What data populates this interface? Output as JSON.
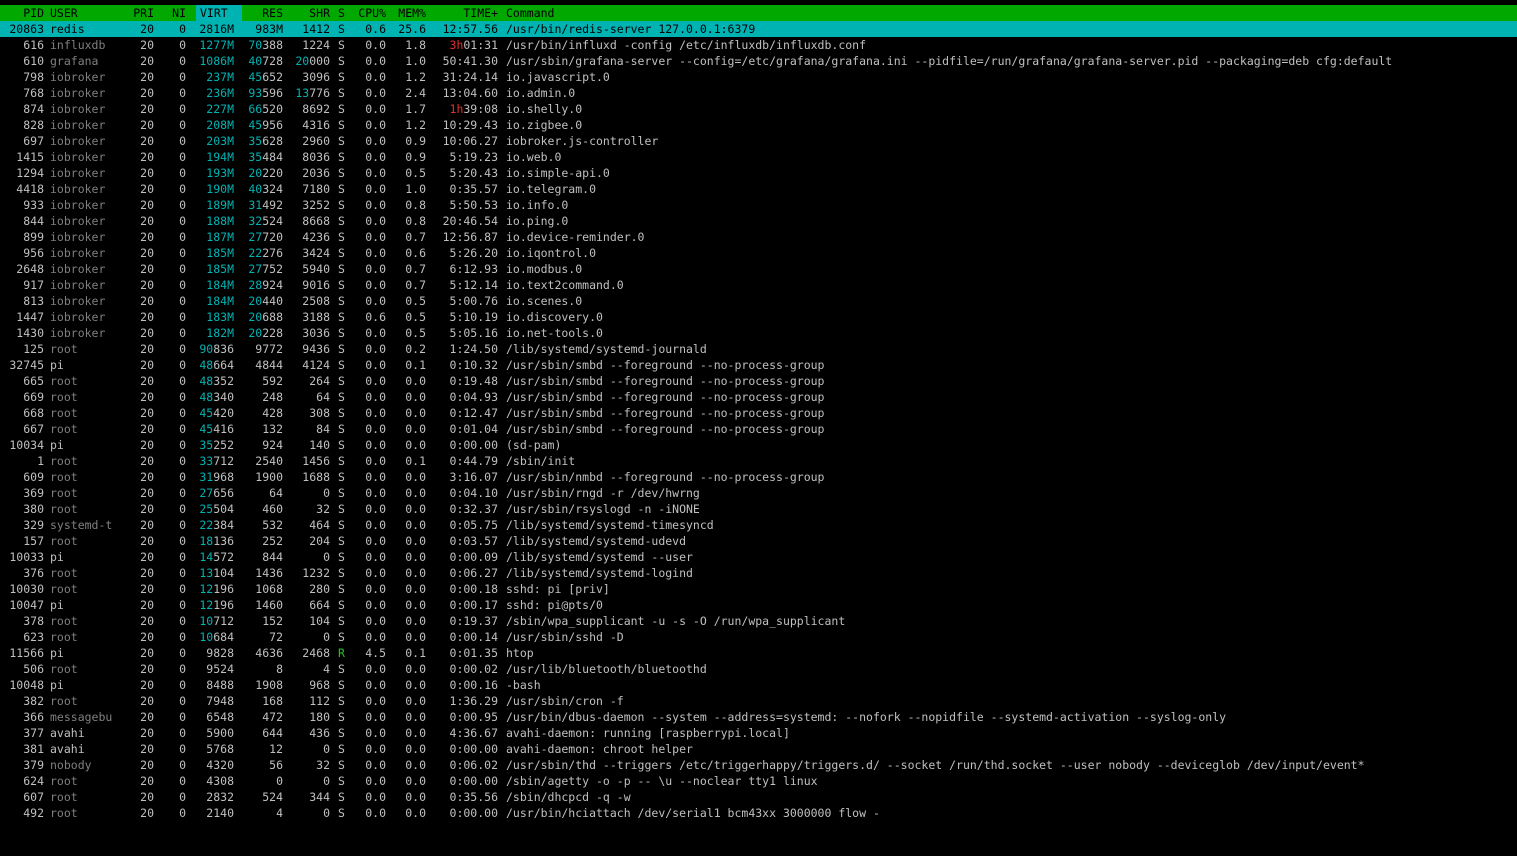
{
  "header": {
    "pid": "PID",
    "user": "USER",
    "pri": "PRI",
    "ni": "NI",
    "virt": "VIRT",
    "res": "RES",
    "shr": "SHR",
    "s": "S",
    "cpu": "CPU%",
    "mem": "MEM%",
    "time": "TIME+",
    "command": "Command"
  },
  "colors": {
    "header_bg": "#00a800",
    "selection_bg": "#00b3b3",
    "virt_cyan": "#00b3b3",
    "time_hours_red": "#e03030",
    "running_green": "#22c322",
    "background": "#000000"
  },
  "processes": [
    {
      "pid": "20863",
      "user": "redis",
      "pri": "20",
      "ni": "0",
      "virt": "2816M",
      "res": "983M",
      "shr": "1412",
      "s": "S",
      "cpu": "0.6",
      "mem": "25.6",
      "time_h": "",
      "time": "12:57.56",
      "command": "/usr/bin/redis-server 127.0.0.1:6379"
    },
    {
      "pid": "616",
      "user": "influxdb",
      "pri": "20",
      "ni": "0",
      "virt": "1277M",
      "res": "70388",
      "shr": "1224",
      "s": "S",
      "cpu": "0.0",
      "mem": "1.8",
      "time_h": "3h",
      "time": "01:31",
      "command": "/usr/bin/influxd -config /etc/influxdb/influxdb.conf"
    },
    {
      "pid": "610",
      "user": "grafana",
      "pri": "20",
      "ni": "0",
      "virt": "1086M",
      "res": "40728",
      "shr": "20000",
      "s": "S",
      "cpu": "0.0",
      "mem": "1.0",
      "time_h": "",
      "time": "50:41.30",
      "command": "/usr/sbin/grafana-server --config=/etc/grafana/grafana.ini --pidfile=/run/grafana/grafana-server.pid --packaging=deb cfg:default"
    },
    {
      "pid": "798",
      "user": "iobroker",
      "pri": "20",
      "ni": "0",
      "virt": "237M",
      "res": "45652",
      "shr": "3096",
      "s": "S",
      "cpu": "0.0",
      "mem": "1.2",
      "time_h": "",
      "time": "31:24.14",
      "command": "io.javascript.0"
    },
    {
      "pid": "768",
      "user": "iobroker",
      "pri": "20",
      "ni": "0",
      "virt": "236M",
      "res": "93596",
      "shr": "13776",
      "s": "S",
      "cpu": "0.0",
      "mem": "2.4",
      "time_h": "",
      "time": "13:04.60",
      "command": "io.admin.0"
    },
    {
      "pid": "874",
      "user": "iobroker",
      "pri": "20",
      "ni": "0",
      "virt": "227M",
      "res": "66520",
      "shr": "8692",
      "s": "S",
      "cpu": "0.0",
      "mem": "1.7",
      "time_h": "1h",
      "time": "39:08",
      "command": "io.shelly.0"
    },
    {
      "pid": "828",
      "user": "iobroker",
      "pri": "20",
      "ni": "0",
      "virt": "208M",
      "res": "45956",
      "shr": "4316",
      "s": "S",
      "cpu": "0.0",
      "mem": "1.2",
      "time_h": "",
      "time": "10:29.43",
      "command": "io.zigbee.0"
    },
    {
      "pid": "697",
      "user": "iobroker",
      "pri": "20",
      "ni": "0",
      "virt": "203M",
      "res": "35628",
      "shr": "2960",
      "s": "S",
      "cpu": "0.0",
      "mem": "0.9",
      "time_h": "",
      "time": "10:06.27",
      "command": "iobroker.js-controller"
    },
    {
      "pid": "1415",
      "user": "iobroker",
      "pri": "20",
      "ni": "0",
      "virt": "194M",
      "res": "35484",
      "shr": "8036",
      "s": "S",
      "cpu": "0.0",
      "mem": "0.9",
      "time_h": "",
      "time": "5:19.23",
      "command": "io.web.0"
    },
    {
      "pid": "1294",
      "user": "iobroker",
      "pri": "20",
      "ni": "0",
      "virt": "193M",
      "res": "20220",
      "shr": "2036",
      "s": "S",
      "cpu": "0.0",
      "mem": "0.5",
      "time_h": "",
      "time": "5:20.43",
      "command": "io.simple-api.0"
    },
    {
      "pid": "4418",
      "user": "iobroker",
      "pri": "20",
      "ni": "0",
      "virt": "190M",
      "res": "40324",
      "shr": "7180",
      "s": "S",
      "cpu": "0.0",
      "mem": "1.0",
      "time_h": "",
      "time": "0:35.57",
      "command": "io.telegram.0"
    },
    {
      "pid": "933",
      "user": "iobroker",
      "pri": "20",
      "ni": "0",
      "virt": "189M",
      "res": "31492",
      "shr": "3252",
      "s": "S",
      "cpu": "0.0",
      "mem": "0.8",
      "time_h": "",
      "time": "5:50.53",
      "command": "io.info.0"
    },
    {
      "pid": "844",
      "user": "iobroker",
      "pri": "20",
      "ni": "0",
      "virt": "188M",
      "res": "32524",
      "shr": "8668",
      "s": "S",
      "cpu": "0.0",
      "mem": "0.8",
      "time_h": "",
      "time": "20:46.54",
      "command": "io.ping.0"
    },
    {
      "pid": "899",
      "user": "iobroker",
      "pri": "20",
      "ni": "0",
      "virt": "187M",
      "res": "27720",
      "shr": "4236",
      "s": "S",
      "cpu": "0.0",
      "mem": "0.7",
      "time_h": "",
      "time": "12:56.87",
      "command": "io.device-reminder.0"
    },
    {
      "pid": "956",
      "user": "iobroker",
      "pri": "20",
      "ni": "0",
      "virt": "185M",
      "res": "22276",
      "shr": "3424",
      "s": "S",
      "cpu": "0.0",
      "mem": "0.6",
      "time_h": "",
      "time": "5:26.20",
      "command": "io.iqontrol.0"
    },
    {
      "pid": "2648",
      "user": "iobroker",
      "pri": "20",
      "ni": "0",
      "virt": "185M",
      "res": "27752",
      "shr": "5940",
      "s": "S",
      "cpu": "0.0",
      "mem": "0.7",
      "time_h": "",
      "time": "6:12.93",
      "command": "io.modbus.0"
    },
    {
      "pid": "917",
      "user": "iobroker",
      "pri": "20",
      "ni": "0",
      "virt": "184M",
      "res": "28924",
      "shr": "9016",
      "s": "S",
      "cpu": "0.0",
      "mem": "0.7",
      "time_h": "",
      "time": "5:12.14",
      "command": "io.text2command.0"
    },
    {
      "pid": "813",
      "user": "iobroker",
      "pri": "20",
      "ni": "0",
      "virt": "184M",
      "res": "20440",
      "shr": "2508",
      "s": "S",
      "cpu": "0.0",
      "mem": "0.5",
      "time_h": "",
      "time": "5:00.76",
      "command": "io.scenes.0"
    },
    {
      "pid": "1447",
      "user": "iobroker",
      "pri": "20",
      "ni": "0",
      "virt": "183M",
      "res": "20688",
      "shr": "3188",
      "s": "S",
      "cpu": "0.6",
      "mem": "0.5",
      "time_h": "",
      "time": "5:10.19",
      "command": "io.discovery.0"
    },
    {
      "pid": "1430",
      "user": "iobroker",
      "pri": "20",
      "ni": "0",
      "virt": "182M",
      "res": "20228",
      "shr": "3036",
      "s": "S",
      "cpu": "0.0",
      "mem": "0.5",
      "time_h": "",
      "time": "5:05.16",
      "command": "io.net-tools.0"
    },
    {
      "pid": "125",
      "user": "root",
      "pri": "20",
      "ni": "0",
      "virt": "90836",
      "res": "9772",
      "shr": "9436",
      "s": "S",
      "cpu": "0.0",
      "mem": "0.2",
      "time_h": "",
      "time": "1:24.50",
      "command": "/lib/systemd/systemd-journald"
    },
    {
      "pid": "32745",
      "user": "pi",
      "pri": "20",
      "ni": "0",
      "virt": "48664",
      "res": "4844",
      "shr": "4124",
      "s": "S",
      "cpu": "0.0",
      "mem": "0.1",
      "time_h": "",
      "time": "0:10.32",
      "command": "/usr/sbin/smbd --foreground --no-process-group"
    },
    {
      "pid": "665",
      "user": "root",
      "pri": "20",
      "ni": "0",
      "virt": "48352",
      "res": "592",
      "shr": "264",
      "s": "S",
      "cpu": "0.0",
      "mem": "0.0",
      "time_h": "",
      "time": "0:19.48",
      "command": "/usr/sbin/smbd --foreground --no-process-group"
    },
    {
      "pid": "669",
      "user": "root",
      "pri": "20",
      "ni": "0",
      "virt": "48340",
      "res": "248",
      "shr": "64",
      "s": "S",
      "cpu": "0.0",
      "mem": "0.0",
      "time_h": "",
      "time": "0:04.93",
      "command": "/usr/sbin/smbd --foreground --no-process-group"
    },
    {
      "pid": "668",
      "user": "root",
      "pri": "20",
      "ni": "0",
      "virt": "45420",
      "res": "428",
      "shr": "308",
      "s": "S",
      "cpu": "0.0",
      "mem": "0.0",
      "time_h": "",
      "time": "0:12.47",
      "command": "/usr/sbin/smbd --foreground --no-process-group"
    },
    {
      "pid": "667",
      "user": "root",
      "pri": "20",
      "ni": "0",
      "virt": "45416",
      "res": "132",
      "shr": "84",
      "s": "S",
      "cpu": "0.0",
      "mem": "0.0",
      "time_h": "",
      "time": "0:01.04",
      "command": "/usr/sbin/smbd --foreground --no-process-group"
    },
    {
      "pid": "10034",
      "user": "pi",
      "pri": "20",
      "ni": "0",
      "virt": "35252",
      "res": "924",
      "shr": "140",
      "s": "S",
      "cpu": "0.0",
      "mem": "0.0",
      "time_h": "",
      "time": "0:00.00",
      "command": "(sd-pam)"
    },
    {
      "pid": "1",
      "user": "root",
      "pri": "20",
      "ni": "0",
      "virt": "33712",
      "res": "2540",
      "shr": "1456",
      "s": "S",
      "cpu": "0.0",
      "mem": "0.1",
      "time_h": "",
      "time": "0:44.79",
      "command": "/sbin/init"
    },
    {
      "pid": "609",
      "user": "root",
      "pri": "20",
      "ni": "0",
      "virt": "31968",
      "res": "1900",
      "shr": "1688",
      "s": "S",
      "cpu": "0.0",
      "mem": "0.0",
      "time_h": "",
      "time": "3:16.07",
      "command": "/usr/sbin/nmbd --foreground --no-process-group"
    },
    {
      "pid": "369",
      "user": "root",
      "pri": "20",
      "ni": "0",
      "virt": "27656",
      "res": "64",
      "shr": "0",
      "s": "S",
      "cpu": "0.0",
      "mem": "0.0",
      "time_h": "",
      "time": "0:04.10",
      "command": "/usr/sbin/rngd -r /dev/hwrng"
    },
    {
      "pid": "380",
      "user": "root",
      "pri": "20",
      "ni": "0",
      "virt": "25504",
      "res": "460",
      "shr": "32",
      "s": "S",
      "cpu": "0.0",
      "mem": "0.0",
      "time_h": "",
      "time": "0:32.37",
      "command": "/usr/sbin/rsyslogd -n -iNONE"
    },
    {
      "pid": "329",
      "user": "systemd-t",
      "pri": "20",
      "ni": "0",
      "virt": "22384",
      "res": "532",
      "shr": "464",
      "s": "S",
      "cpu": "0.0",
      "mem": "0.0",
      "time_h": "",
      "time": "0:05.75",
      "command": "/lib/systemd/systemd-timesyncd"
    },
    {
      "pid": "157",
      "user": "root",
      "pri": "20",
      "ni": "0",
      "virt": "18136",
      "res": "252",
      "shr": "204",
      "s": "S",
      "cpu": "0.0",
      "mem": "0.0",
      "time_h": "",
      "time": "0:03.57",
      "command": "/lib/systemd/systemd-udevd"
    },
    {
      "pid": "10033",
      "user": "pi",
      "pri": "20",
      "ni": "0",
      "virt": "14572",
      "res": "844",
      "shr": "0",
      "s": "S",
      "cpu": "0.0",
      "mem": "0.0",
      "time_h": "",
      "time": "0:00.09",
      "command": "/lib/systemd/systemd --user"
    },
    {
      "pid": "376",
      "user": "root",
      "pri": "20",
      "ni": "0",
      "virt": "13104",
      "res": "1436",
      "shr": "1232",
      "s": "S",
      "cpu": "0.0",
      "mem": "0.0",
      "time_h": "",
      "time": "0:06.27",
      "command": "/lib/systemd/systemd-logind"
    },
    {
      "pid": "10030",
      "user": "root",
      "pri": "20",
      "ni": "0",
      "virt": "12196",
      "res": "1068",
      "shr": "280",
      "s": "S",
      "cpu": "0.0",
      "mem": "0.0",
      "time_h": "",
      "time": "0:00.18",
      "command": "sshd: pi [priv]"
    },
    {
      "pid": "10047",
      "user": "pi",
      "pri": "20",
      "ni": "0",
      "virt": "12196",
      "res": "1460",
      "shr": "664",
      "s": "S",
      "cpu": "0.0",
      "mem": "0.0",
      "time_h": "",
      "time": "0:00.17",
      "command": "sshd: pi@pts/0"
    },
    {
      "pid": "378",
      "user": "root",
      "pri": "20",
      "ni": "0",
      "virt": "10712",
      "res": "152",
      "shr": "104",
      "s": "S",
      "cpu": "0.0",
      "mem": "0.0",
      "time_h": "",
      "time": "0:19.37",
      "command": "/sbin/wpa_supplicant -u -s -O /run/wpa_supplicant"
    },
    {
      "pid": "623",
      "user": "root",
      "pri": "20",
      "ni": "0",
      "virt": "10684",
      "res": "72",
      "shr": "0",
      "s": "S",
      "cpu": "0.0",
      "mem": "0.0",
      "time_h": "",
      "time": "0:00.14",
      "command": "/usr/sbin/sshd -D"
    },
    {
      "pid": "11566",
      "user": "pi",
      "pri": "20",
      "ni": "0",
      "virt": "9828",
      "res": "4636",
      "shr": "2468",
      "s": "R",
      "cpu": "4.5",
      "mem": "0.1",
      "time_h": "",
      "time": "0:01.35",
      "command": "htop"
    },
    {
      "pid": "506",
      "user": "root",
      "pri": "20",
      "ni": "0",
      "virt": "9524",
      "res": "8",
      "shr": "4",
      "s": "S",
      "cpu": "0.0",
      "mem": "0.0",
      "time_h": "",
      "time": "0:00.02",
      "command": "/usr/lib/bluetooth/bluetoothd"
    },
    {
      "pid": "10048",
      "user": "pi",
      "pri": "20",
      "ni": "0",
      "virt": "8488",
      "res": "1908",
      "shr": "968",
      "s": "S",
      "cpu": "0.0",
      "mem": "0.0",
      "time_h": "",
      "time": "0:00.16",
      "command": "-bash"
    },
    {
      "pid": "382",
      "user": "root",
      "pri": "20",
      "ni": "0",
      "virt": "7948",
      "res": "168",
      "shr": "112",
      "s": "S",
      "cpu": "0.0",
      "mem": "0.0",
      "time_h": "",
      "time": "1:36.29",
      "command": "/usr/sbin/cron -f"
    },
    {
      "pid": "366",
      "user": "messagebu",
      "pri": "20",
      "ni": "0",
      "virt": "6548",
      "res": "472",
      "shr": "180",
      "s": "S",
      "cpu": "0.0",
      "mem": "0.0",
      "time_h": "",
      "time": "0:00.95",
      "command": "/usr/bin/dbus-daemon --system --address=systemd: --nofork --nopidfile --systemd-activation --syslog-only"
    },
    {
      "pid": "377",
      "user": "avahi",
      "pri": "20",
      "ni": "0",
      "virt": "5900",
      "res": "644",
      "shr": "436",
      "s": "S",
      "cpu": "0.0",
      "mem": "0.0",
      "time_h": "",
      "time": "4:36.67",
      "command": "avahi-daemon: running [raspberrypi.local]"
    },
    {
      "pid": "381",
      "user": "avahi",
      "pri": "20",
      "ni": "0",
      "virt": "5768",
      "res": "12",
      "shr": "0",
      "s": "S",
      "cpu": "0.0",
      "mem": "0.0",
      "time_h": "",
      "time": "0:00.00",
      "command": "avahi-daemon: chroot helper"
    },
    {
      "pid": "379",
      "user": "nobody",
      "pri": "20",
      "ni": "0",
      "virt": "4320",
      "res": "56",
      "shr": "32",
      "s": "S",
      "cpu": "0.0",
      "mem": "0.0",
      "time_h": "",
      "time": "0:06.02",
      "command": "/usr/sbin/thd --triggers /etc/triggerhappy/triggers.d/ --socket /run/thd.socket --user nobody --deviceglob /dev/input/event*"
    },
    {
      "pid": "624",
      "user": "root",
      "pri": "20",
      "ni": "0",
      "virt": "4308",
      "res": "0",
      "shr": "0",
      "s": "S",
      "cpu": "0.0",
      "mem": "0.0",
      "time_h": "",
      "time": "0:00.00",
      "command": "/sbin/agetty -o -p -- \\u --noclear tty1 linux"
    },
    {
      "pid": "607",
      "user": "root",
      "pri": "20",
      "ni": "0",
      "virt": "2832",
      "res": "524",
      "shr": "344",
      "s": "S",
      "cpu": "0.0",
      "mem": "0.0",
      "time_h": "",
      "time": "0:35.56",
      "command": "/sbin/dhcpcd -q -w"
    },
    {
      "pid": "492",
      "user": "root",
      "pri": "20",
      "ni": "0",
      "virt": "2140",
      "res": "4",
      "shr": "0",
      "s": "S",
      "cpu": "0.0",
      "mem": "0.0",
      "time_h": "",
      "time": "0:00.00",
      "command": "/usr/bin/hciattach /dev/serial1 bcm43xx 3000000 flow -"
    }
  ]
}
